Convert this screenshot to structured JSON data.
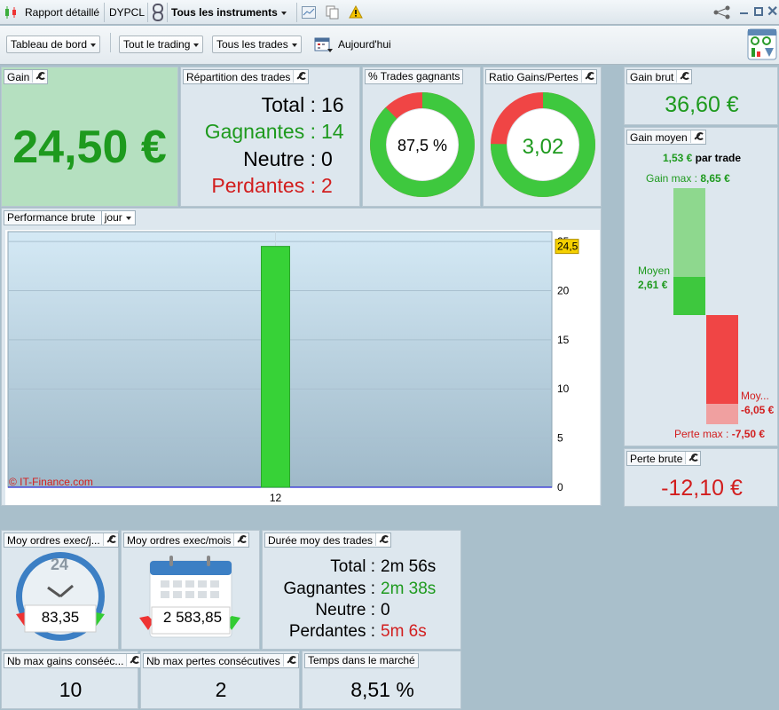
{
  "topbar": {
    "report": "Rapport détaillé",
    "account": "DYPCL",
    "instruments": "Tous les instruments"
  },
  "toolbar": {
    "dashboard": "Tableau de bord",
    "trading": "Tout le trading",
    "trades": "Tous les trades",
    "date": "Aujourd'hui"
  },
  "gain": {
    "title": "Gain",
    "value": "24,50 €"
  },
  "repartition": {
    "title": "Répartition des trades",
    "total_label": "Total :",
    "total": "16",
    "win_label": "Gagnantes :",
    "win": "14",
    "neutral_label": "Neutre :",
    "neutral": "0",
    "loss_label": "Perdantes :",
    "loss": "2"
  },
  "pct_win": {
    "title": "% Trades gagnants",
    "value": "87,5 %",
    "fraction": 0.875
  },
  "ratio": {
    "title": "Ratio Gains/Pertes",
    "value": "3,02",
    "fraction": 0.7513
  },
  "gain_brut": {
    "title": "Gain brut",
    "value": "36,60 €"
  },
  "gain_moyen": {
    "title": "Gain moyen",
    "per_trade_value": "1,53 €",
    "per_trade_label": "par trade",
    "max_gain_label": "Gain max :",
    "max_gain": "8,65 €",
    "avg_label": "Moyen",
    "avg_gain": "2,61 €",
    "avg_loss_label": "Moy...",
    "avg_loss": "-6,05 €",
    "max_loss_label": "Perte max :",
    "max_loss": "-7,50 €"
  },
  "perte_brute": {
    "title": "Perte brute",
    "value": "-12,10 €"
  },
  "performance": {
    "title": "Performance brute",
    "period": "jour",
    "watermark": "© IT-Finance.com",
    "last_value_label": "24,5"
  },
  "chart_data": {
    "type": "bar",
    "categories": [
      "12"
    ],
    "values": [
      24.5
    ],
    "ylim": [
      0,
      26
    ],
    "yticks": [
      "0",
      "5",
      "10",
      "15",
      "20",
      "25"
    ],
    "colors": {
      "bar": "#37d237",
      "zero_line": "#2b2bd6"
    }
  },
  "ordres_jour": {
    "title": "Moy ordres exec/j...",
    "clock_label": "24",
    "value": "83,35"
  },
  "ordres_mois": {
    "title": "Moy ordres exec/mois",
    "value": "2 583,85"
  },
  "duree": {
    "title": "Durée moy des trades",
    "total_label": "Total :",
    "total": "2m 56s",
    "win_label": "Gagnantes :",
    "win": "2m 38s",
    "neutral_label": "Neutre :",
    "neutral": "0",
    "loss_label": "Perdantes :",
    "loss": "5m 6s"
  },
  "max_gains": {
    "title": "Nb max gains consééc...",
    "value": "10"
  },
  "max_pertes": {
    "title": "Nb max pertes consécutives",
    "value": "2"
  },
  "temps": {
    "title": "Temps dans le marché",
    "value": "8,51 %"
  },
  "colors": {
    "green": "#3ec83e",
    "red": "#f04545",
    "gain_bg": "#b5e0c0"
  }
}
